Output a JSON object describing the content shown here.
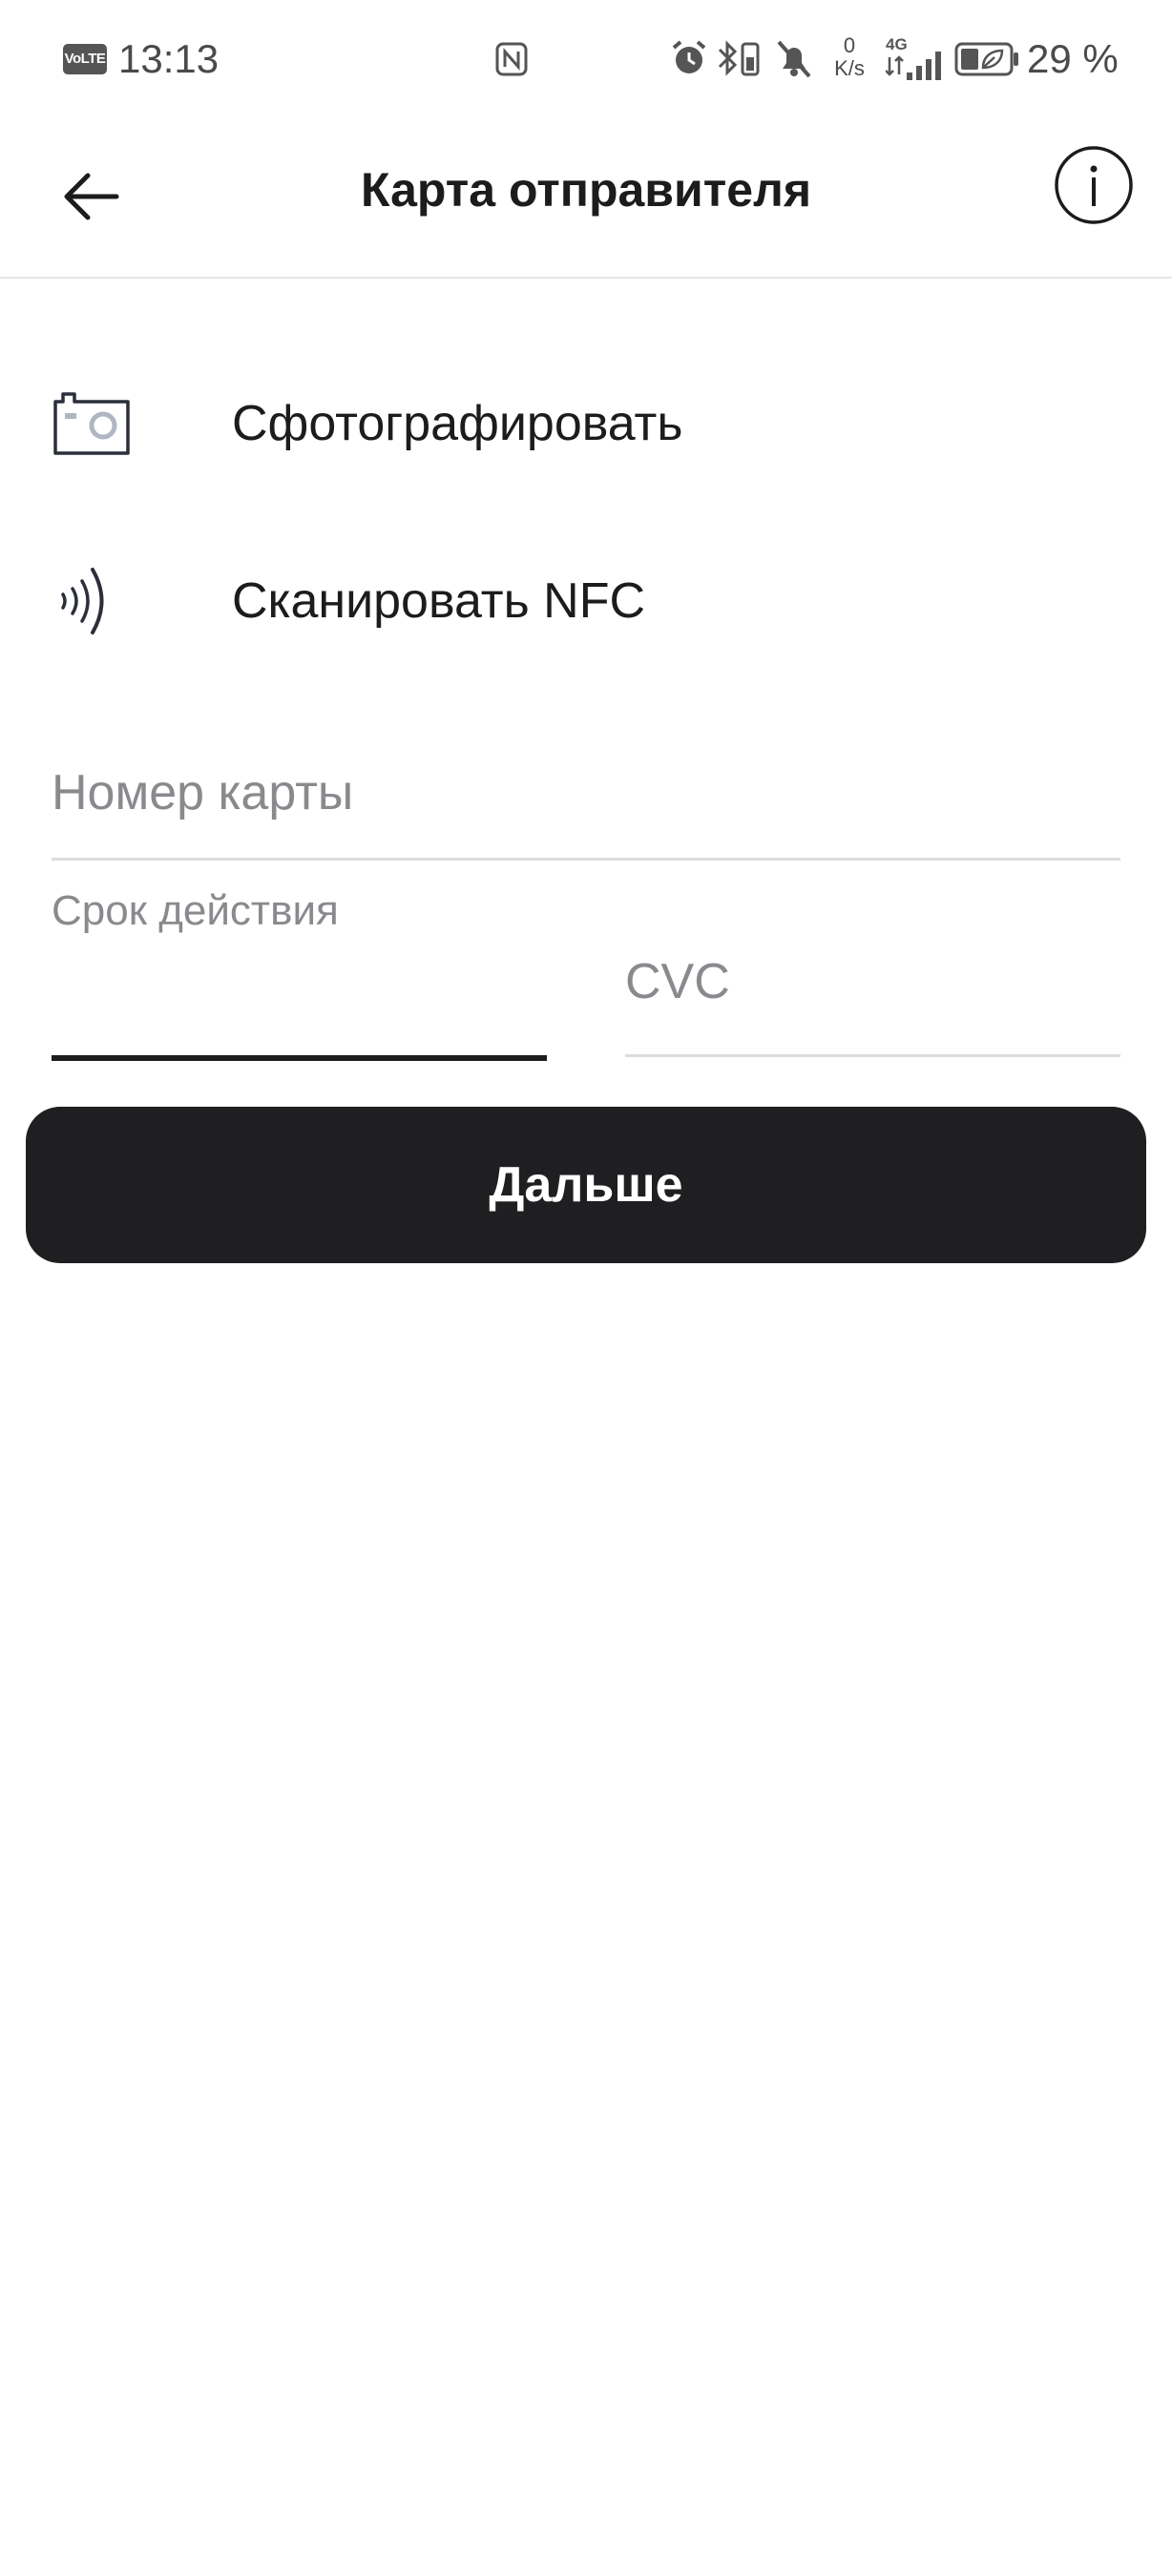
{
  "status_bar": {
    "network_badge": "VoLTE",
    "time": "13:13",
    "speed_value": "0",
    "speed_unit": "K/s",
    "network_type": "4G",
    "battery": "29 %"
  },
  "header": {
    "title": "Карта отправителя"
  },
  "actions": [
    {
      "label": "Сфотографировать",
      "icon": "camera-icon"
    },
    {
      "label": "Сканировать NFC",
      "icon": "nfc-icon"
    }
  ],
  "form": {
    "card_number": {
      "value": "",
      "placeholder": "Номер карты"
    },
    "expiry": {
      "label": "Срок действия",
      "value": ""
    },
    "cvc": {
      "value": "",
      "placeholder": "CVC"
    }
  },
  "next_button": {
    "label": "Дальше"
  },
  "colors": {
    "primary": "#1f1f21",
    "placeholder": "#8a8a8e",
    "divider": "#dcdcdc",
    "text": "#1c1c1e",
    "background": "#ffffff"
  }
}
